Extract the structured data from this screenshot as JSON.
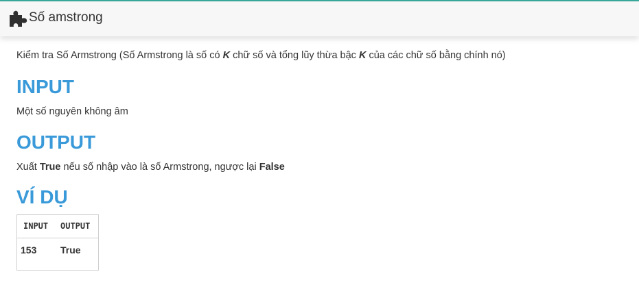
{
  "header": {
    "title": "Số amstrong",
    "icon": "puzzle-piece-icon"
  },
  "description": {
    "part1": "Kiểm tra Số Armstrong (Số Armstrong là số có ",
    "k1": "K",
    "part2": " chữ số và tổng lũy thừa bậc ",
    "k2": "K",
    "part3": " của các chữ số bằng chính nó)"
  },
  "input_section": {
    "heading": "INPUT",
    "text": "Một số nguyên không âm"
  },
  "output_section": {
    "heading": "OUTPUT",
    "text_before": "Xuất ",
    "bold1": "True",
    "text_middle": " nếu số nhập vào là số Armstrong, ngược lại ",
    "bold2": "False"
  },
  "example_section": {
    "heading": "VÍ DỤ",
    "columns": [
      "INPUT",
      "OUTPUT"
    ],
    "rows": [
      [
        "153",
        "True"
      ]
    ]
  },
  "colors": {
    "accent_heading": "#3a9ad9",
    "top_line": "#3aa99a",
    "header_bg": "#f7f7f7"
  }
}
